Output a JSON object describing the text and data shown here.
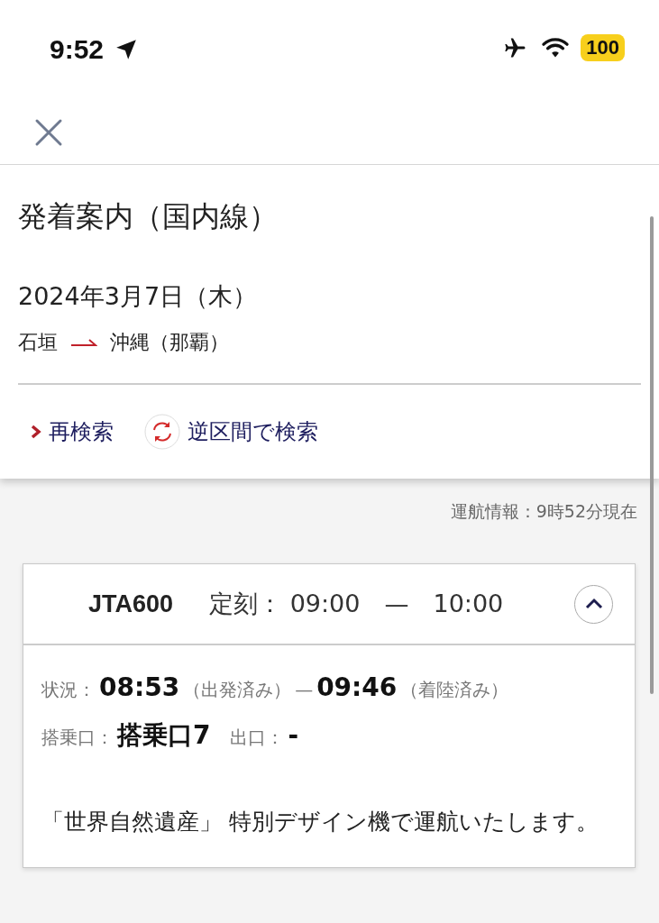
{
  "status_bar": {
    "time": "9:52",
    "battery": "100"
  },
  "page": {
    "title": "発着案内（国内線）",
    "date": "2024年3月7日（木）",
    "route": {
      "from": "石垣",
      "to": "沖縄（那覇）"
    },
    "actions": [
      {
        "kind": "link",
        "label": "再検索"
      },
      {
        "kind": "swap",
        "label": "逆区間で検索"
      }
    ]
  },
  "updated": "運航情報：9時52分現在",
  "flights": [
    {
      "flight": "JTA600",
      "schedule_label": "定刻：",
      "departure": "09:00",
      "dash": "—",
      "arrival": "10:00",
      "expanded": true,
      "status_label": "状況：",
      "actual_departure": "08:53",
      "departure_state": "（出発済み）",
      "status_dash": "—",
      "actual_arrival": "09:46",
      "arrival_state": "（着陸済み）",
      "gate_label": "搭乗口：",
      "gate": "搭乗口7",
      "exit_label": "出口：",
      "exit": "-",
      "note": "「世界自然遺産」 特別デザイン機で運航いたします。"
    }
  ]
}
